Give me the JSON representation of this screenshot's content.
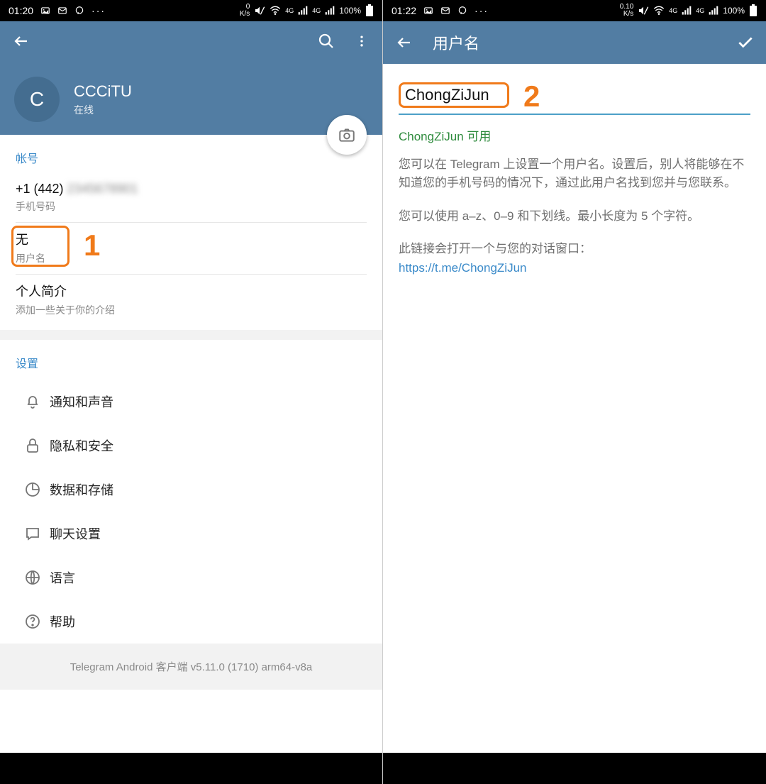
{
  "left": {
    "status": {
      "time": "01:20",
      "net": "0\nK/s",
      "battery": "100%"
    },
    "profile": {
      "avatar_letter": "C",
      "name": "CCCiTU",
      "status": "在线"
    },
    "account": {
      "header": "帐号",
      "phone_prefix": "+1 (442) ",
      "phone_label": "手机号码",
      "username_value": "无",
      "username_label": "用户名",
      "bio_value": "个人简介",
      "bio_label": "添加一些关于你的介绍"
    },
    "settings": {
      "header": "设置",
      "items": [
        {
          "label": "通知和声音"
        },
        {
          "label": "隐私和安全"
        },
        {
          "label": "数据和存储"
        },
        {
          "label": "聊天设置"
        },
        {
          "label": "语言"
        },
        {
          "label": "帮助"
        }
      ]
    },
    "footer": "Telegram Android 客户端 v5.11.0 (1710) arm64-v8a",
    "annotation": "1"
  },
  "right": {
    "status": {
      "time": "01:22",
      "net": "0.10\nK/s",
      "battery": "100%"
    },
    "title": "用户名",
    "input_value": "ChongZiJun",
    "avail": "ChongZiJun 可用",
    "desc1": "您可以在 Telegram 上设置一个用户名。设置后，别人将能够在不知道您的手机号码的情况下，通过此用户名找到您并与您联系。",
    "desc2": "您可以使用 a–z、0–9 和下划线。最小长度为 5 个字符。",
    "link_intro": "此链接会打开一个与您的对话窗口：",
    "link": "https://t.me/ChongZiJun",
    "annotation": "2"
  }
}
